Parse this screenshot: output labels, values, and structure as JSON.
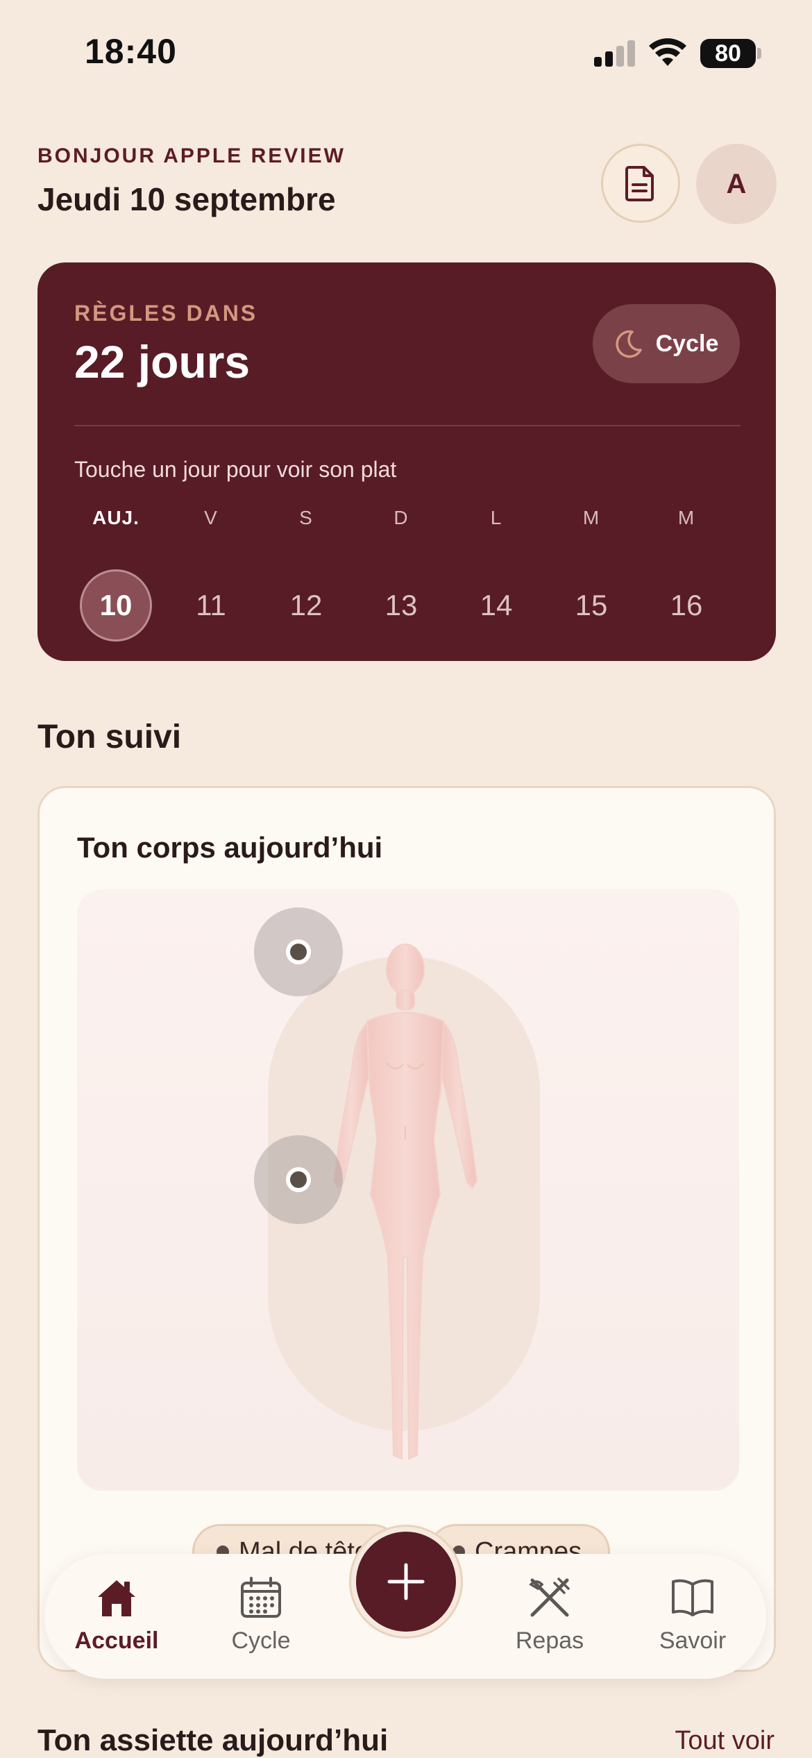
{
  "status_bar": {
    "time": "18:40",
    "battery": "80"
  },
  "header": {
    "greeting": "BONJOUR APPLE REVIEW",
    "date": "Jeudi 10 septembre",
    "avatar_initial": "A",
    "doc_icon": "document-icon"
  },
  "cycle_card": {
    "label": "RÈGLES DANS",
    "value": "22 jours",
    "cycle_button": "Cycle",
    "hint": "Touche un jour pour voir son plat",
    "days": [
      {
        "letter": "AUJ.",
        "number": "10",
        "today": true
      },
      {
        "letter": "V",
        "number": "11"
      },
      {
        "letter": "S",
        "number": "12"
      },
      {
        "letter": "D",
        "number": "13"
      },
      {
        "letter": "L",
        "number": "14"
      },
      {
        "letter": "M",
        "number": "15"
      },
      {
        "letter": "M",
        "number": "16"
      }
    ]
  },
  "tracking": {
    "section_title": "Ton suivi",
    "body_card_title": "Ton corps aujourd’hui",
    "symptoms": [
      "Mal de tête",
      "Crampes"
    ]
  },
  "nav": {
    "tabs": [
      {
        "label": "Accueil",
        "icon": "home-icon",
        "active": true
      },
      {
        "label": "Cycle",
        "icon": "calendar-icon"
      },
      {
        "label": "Repas",
        "icon": "utensils-icon"
      },
      {
        "label": "Savoir",
        "icon": "book-icon"
      }
    ],
    "add_icon": "plus-icon"
  },
  "plate": {
    "title": "Ton assiette aujourd’hui",
    "see_all": "Tout voir"
  },
  "colors": {
    "primary": "#581c26",
    "background": "#f6eadf",
    "accent": "#d59880"
  }
}
